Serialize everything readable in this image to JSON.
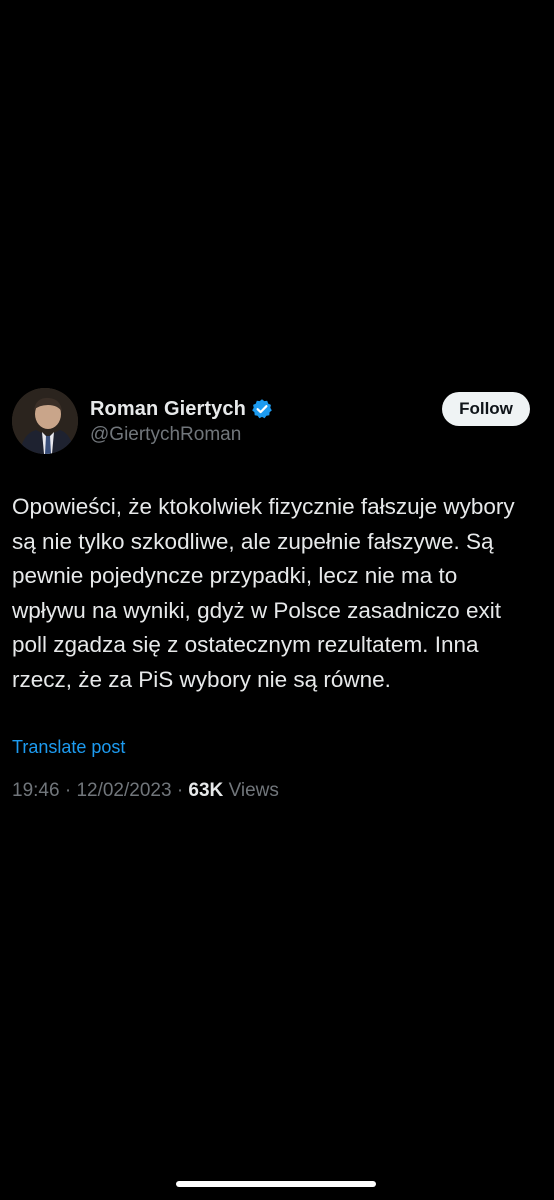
{
  "tweet": {
    "author": {
      "display_name": "Roman Giertych",
      "handle": "@GiertychRoman",
      "verified_icon": "verified-badge-icon",
      "avatar": "profile-photo"
    },
    "follow_label": "Follow",
    "text": "Opowieści, że ktokolwiek fizycznie fałszuje wybory są nie tylko szkodliwe, ale zupełnie fałszywe. Są pewnie pojedyncze przypadki, lecz nie ma to wpływu na wyniki, gdyż w Polsce zasadniczo exit poll zgadza się z ostatecznym rezultatem. Inna rzecz, że za PiS wybory nie są równe.",
    "translate_label": "Translate post",
    "time": "19:46",
    "separator_1": "·",
    "date": "12/02/2023",
    "separator_2": "·",
    "views_count": "63K",
    "views_label": "Views"
  },
  "colors": {
    "background": "#000000",
    "text_primary": "#e7e9ea",
    "text_secondary": "#71767b",
    "accent": "#1d9bf0",
    "follow_bg": "#eff3f4"
  }
}
